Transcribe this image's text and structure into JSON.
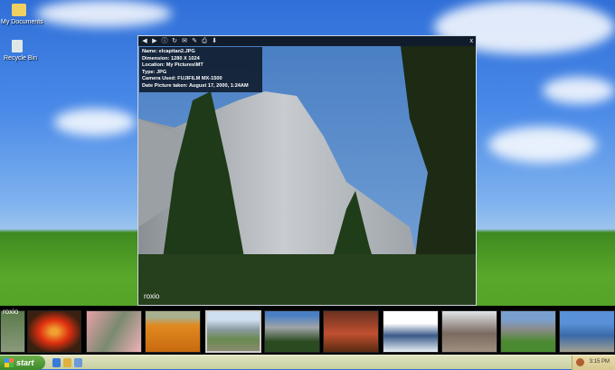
{
  "desktop": {
    "icons": [
      {
        "label": "My Documents"
      },
      {
        "label": "Recycle Bin"
      }
    ]
  },
  "viewer": {
    "toolbar": [
      "prev-icon",
      "next-icon",
      "info-icon",
      "rotate-icon",
      "email-icon",
      "edit-icon",
      "print-icon",
      "save-icon"
    ],
    "toolbar_glyphs": [
      "◀",
      "▶",
      "ⓘ",
      "↻",
      "✉",
      "✎",
      "⎙",
      "⬇"
    ],
    "close_label": "x",
    "info": {
      "name": "Name: elcapitan2.JPG",
      "dimension": "Dimension: 1280 X 1024",
      "location": "Location: My Pictures\\MT",
      "type": "Type: JPG",
      "camera": "Camera Used: FUJIFILM  MX-1500",
      "date": "Date Picture taken: August 17, 2000, 1:24AM"
    },
    "watermark": "roxio"
  },
  "filmstrip": {
    "logo": "roxio",
    "selected_index": 4
  },
  "taskbar": {
    "start": "start",
    "clock": "3:15 PM"
  }
}
